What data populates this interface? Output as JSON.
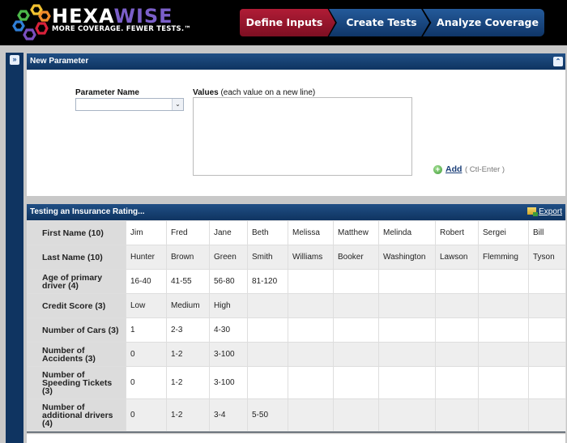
{
  "app": {
    "brand_part1": "HEXA",
    "brand_part2": "WISE",
    "tagline": "MORE COVERAGE. FEWER TESTS.™",
    "colors": {
      "brand_purple": "#7b5fc9",
      "active_step": "#a3182f",
      "step": "#1a4a85",
      "panel": "#0f3461"
    }
  },
  "steps": [
    {
      "label": "Define Inputs",
      "active": true
    },
    {
      "label": "Create Tests",
      "active": false
    },
    {
      "label": "Analyze Coverage",
      "active": false
    }
  ],
  "sidebar": {
    "expand_icon": "»"
  },
  "new_parameter": {
    "title": "New Parameter",
    "collapse_icon": "⌃",
    "param_name_label": "Parameter Name",
    "param_name_value": "",
    "values_label_bold": "Values",
    "values_label_hint": " (each value on a new line)",
    "values_value": "",
    "add_label": "Add",
    "add_hint": "( Ctl-Enter )"
  },
  "table_panel": {
    "title": "Testing an Insurance Rating...",
    "export_label": "Export"
  },
  "parameters": [
    {
      "name": "First Name (10)",
      "values": [
        "Jim",
        "Fred",
        "Jane",
        "Beth",
        "Melissa",
        "Matthew",
        "Melinda",
        "Robert",
        "Sergei",
        "Bill"
      ]
    },
    {
      "name": "Last Name (10)",
      "values": [
        "Hunter",
        "Brown",
        "Green",
        "Smith",
        "Williams",
        "Booker",
        "Washington",
        "Lawson",
        "Flemming",
        "Tyson"
      ]
    },
    {
      "name": "Age of primary driver (4)",
      "values": [
        "16-40",
        "41-55",
        "56-80",
        "81-120",
        "",
        "",
        "",
        "",
        "",
        ""
      ]
    },
    {
      "name": "Credit Score (3)",
      "values": [
        "Low",
        "Medium",
        "High",
        "",
        "",
        "",
        "",
        "",
        "",
        ""
      ]
    },
    {
      "name": "Number of Cars (3)",
      "values": [
        "1",
        "2-3",
        "4-30",
        "",
        "",
        "",
        "",
        "",
        "",
        ""
      ]
    },
    {
      "name": "Number of Accidents (3)",
      "values": [
        "0",
        "1-2",
        "3-100",
        "",
        "",
        "",
        "",
        "",
        "",
        ""
      ]
    },
    {
      "name": "Number of Speeding Tickets (3)",
      "values": [
        "0",
        "1-2",
        "3-100",
        "",
        "",
        "",
        "",
        "",
        "",
        ""
      ]
    },
    {
      "name": "Number of additional drivers (4)",
      "values": [
        "0",
        "1-2",
        "3-4",
        "5-50",
        "",
        "",
        "",
        "",
        "",
        ""
      ]
    }
  ]
}
